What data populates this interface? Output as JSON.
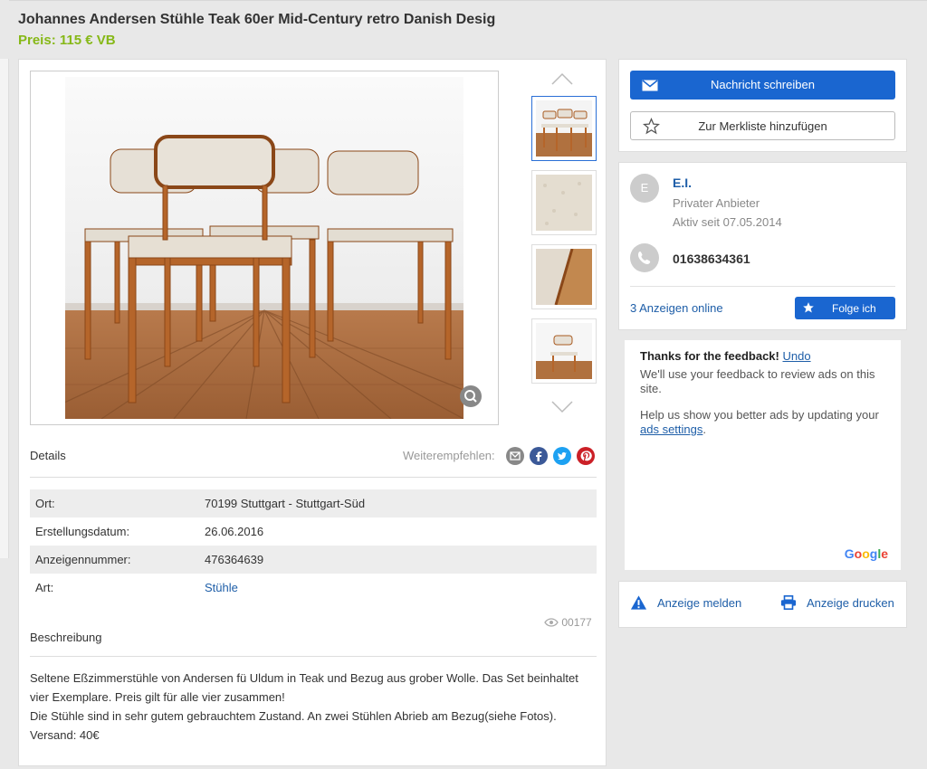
{
  "listing": {
    "title": "Johannes Andersen Stühle Teak 60er Mid-Century retro Danish Desig",
    "price": "Preis: 115 € VB"
  },
  "gallery": {
    "thumbnails": [
      "chairs-set",
      "fabric-closeup",
      "wood-detail",
      "single-chair"
    ]
  },
  "details": {
    "heading": "Details",
    "share_label": "Weiterempfehlen:",
    "rows": [
      {
        "key": "Ort:",
        "value": "70199 Stuttgart - Stuttgart-Süd"
      },
      {
        "key": "Erstellungsdatum:",
        "value": "26.06.2016"
      },
      {
        "key": "Anzeigennummer:",
        "value": "476364639"
      },
      {
        "key": "Art:",
        "value": "Stühle"
      }
    ],
    "views": "00177"
  },
  "description": {
    "heading": "Beschreibung",
    "lines": [
      "Seltene Eßzimmerstühle von Andersen fü Uldum in Teak und Bezug aus grober Wolle. Das Set beinhaltet",
      "vier Exemplare. Preis gilt für alle vier zusammen!",
      "Die Stühle sind in sehr gutem gebrauchtem Zustand. An zwei Stühlen Abrieb am Bezug(siehe Fotos).",
      "Versand: 40€"
    ]
  },
  "actions": {
    "message_label": "Nachricht schreiben",
    "watchlist_label": "Zur Merkliste hinzufügen"
  },
  "seller": {
    "initial": "E",
    "name": "E.I.",
    "type": "Privater Anbieter",
    "since": "Aktiv seit 07.05.2014",
    "phone": "01638634361",
    "ads_online": "3 Anzeigen online",
    "follow_label": "Folge ich"
  },
  "ad_feedback": {
    "title": "Thanks for the feedback!",
    "undo": "Undo",
    "text": "We'll use your feedback to review ads on this site.",
    "help_text": "Help us show you better ads by updating your",
    "settings_link": "ads settings",
    "period": ".",
    "brand": "Google"
  },
  "footer_actions": {
    "report_label": "Anzeige melden",
    "print_label": "Anzeige drucken"
  },
  "colors": {
    "price_green": "#86b817",
    "primary_blue": "#1a66d0",
    "link_blue": "#1e5ea8"
  }
}
